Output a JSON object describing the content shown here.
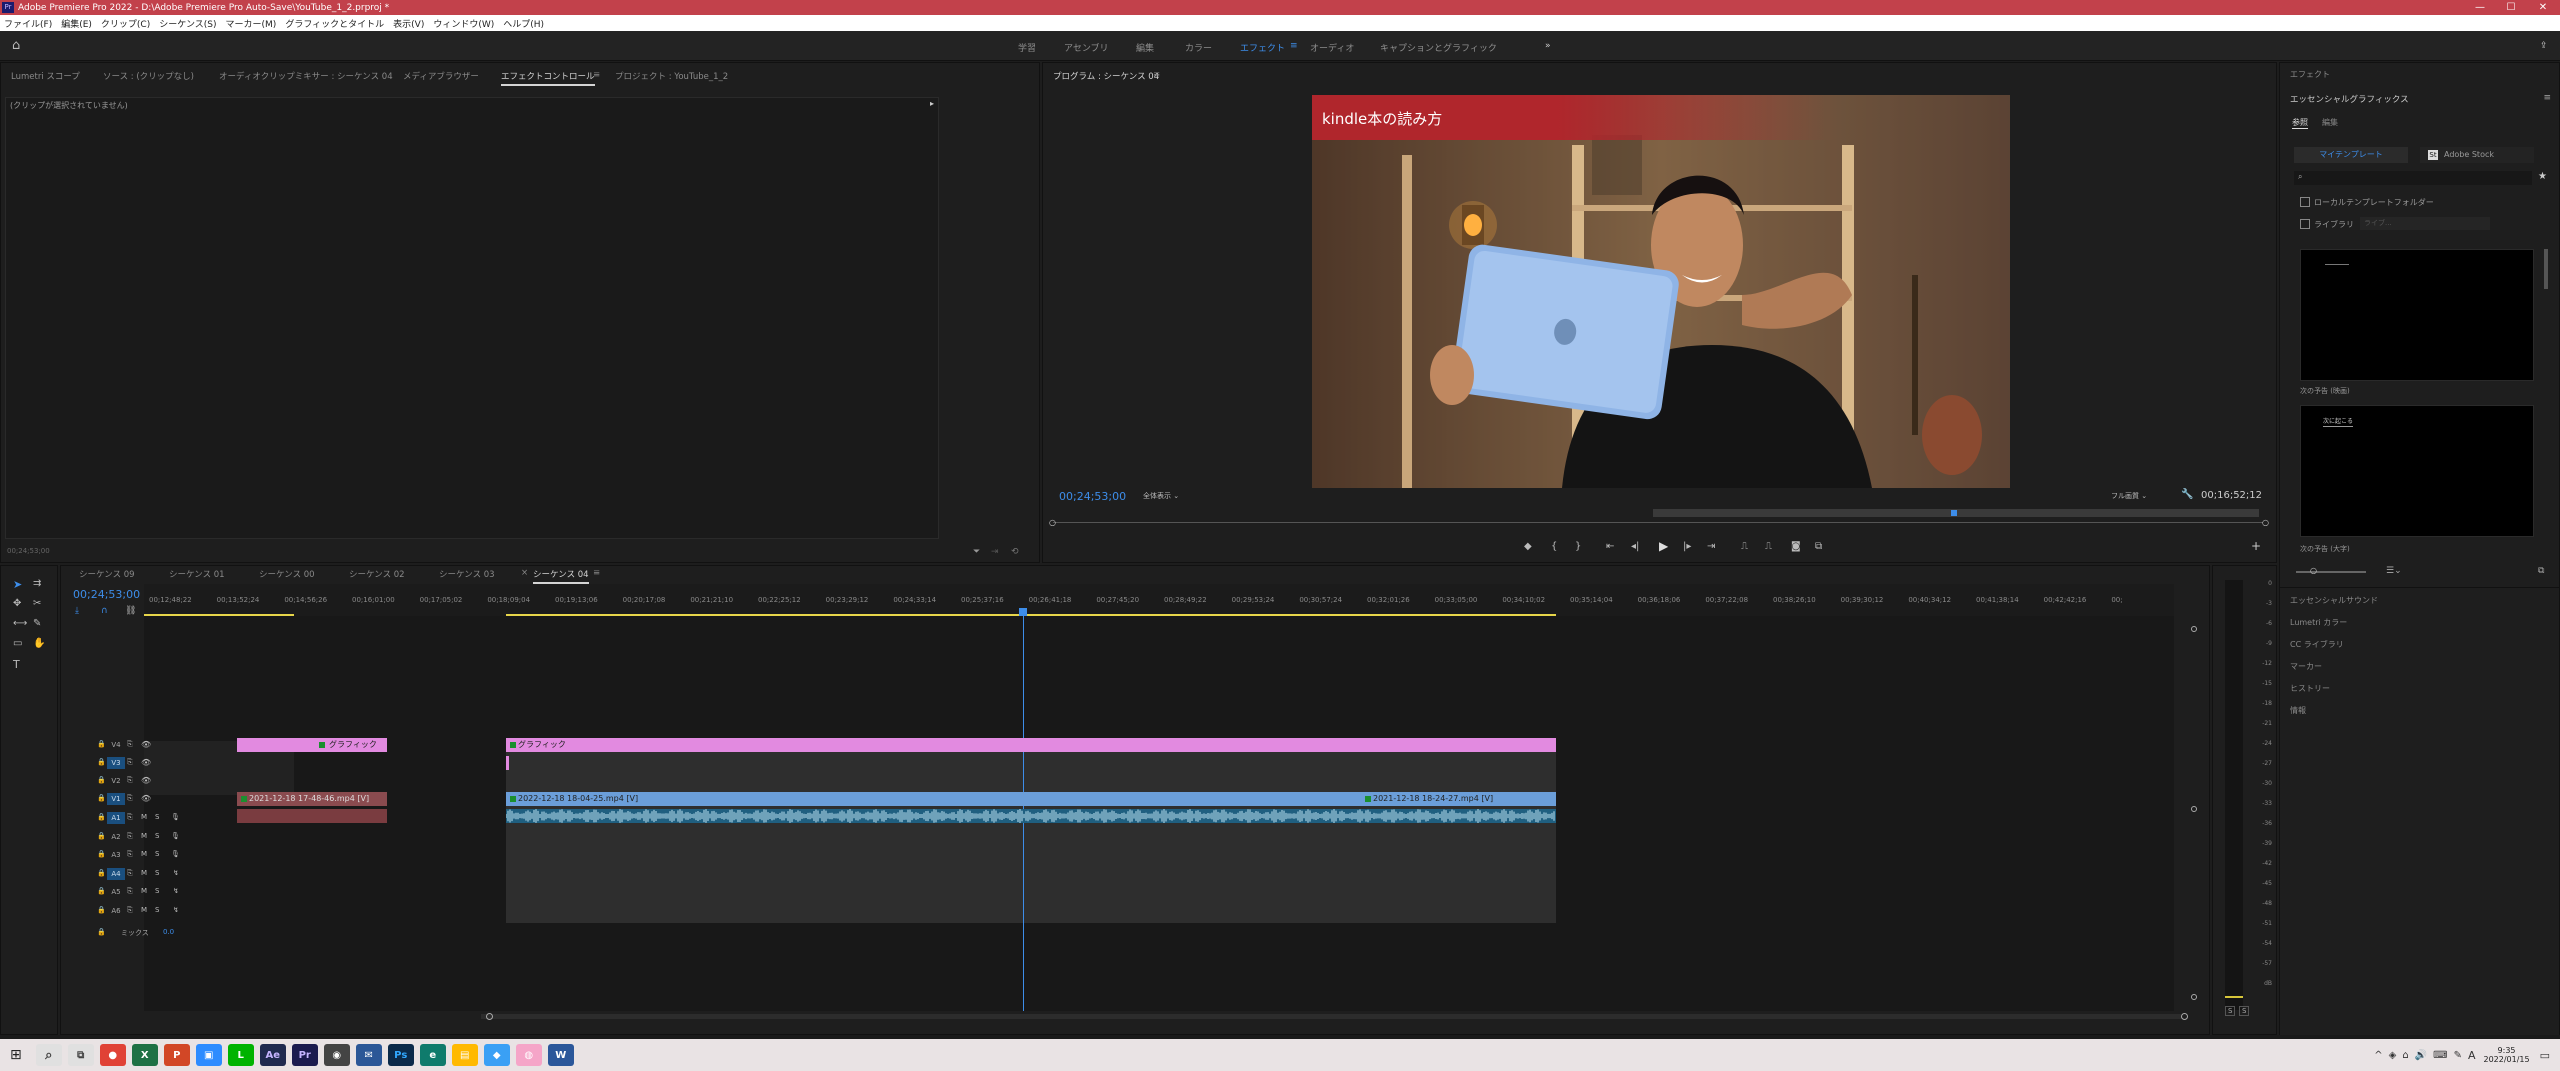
{
  "titlebar": {
    "app_icon": "Pr",
    "title": "Adobe Premiere Pro 2022 - D:\\Adobe Premiere Pro Auto-Save\\YouTube_1_2.prproj *",
    "minimize": "—",
    "maximize": "☐",
    "close": "✕"
  },
  "menu": [
    "ファイル(F)",
    "編集(E)",
    "クリップ(C)",
    "シーケンス(S)",
    "マーカー(M)",
    "グラフィックとタイトル",
    "表示(V)",
    "ウィンドウ(W)",
    "ヘルプ(H)"
  ],
  "workspaces": [
    "学習",
    "アセンブリ",
    "編集",
    "カラー",
    "エフェクト",
    "オーディオ",
    "キャプションとグラフィック"
  ],
  "workspaces_active": "エフェクト",
  "source_panel": {
    "tabs": [
      "Lumetri スコープ",
      "ソース : (クリップなし)",
      "オーディオクリップミキサー : シーケンス 04",
      "メディアブラウザー",
      "エフェクトコントロール",
      "プロジェクト : YouTube_1_2"
    ],
    "active_tab": "エフェクトコントロール",
    "no_clip_text": "(クリップが選択されていません)",
    "timecode": "00;24;53;00"
  },
  "program": {
    "tab": "プログラム : シーケンス 04",
    "title_overlay": "kindle本の読み方",
    "timecode": "00;24;53;00",
    "fit": "全体表示",
    "quality": "フル画質",
    "duration": "00;16;52;12"
  },
  "sequence_tabs": [
    "シーケンス 09",
    "シーケンス 01",
    "シーケンス 00",
    "シーケンス 02",
    "シーケンス 03",
    "シーケンス 04"
  ],
  "active_sequence": "シーケンス 04",
  "timeline": {
    "timecode": "00;24;53;00",
    "ruler": [
      "00;12;48;22",
      "00;13;52;24",
      "00;14;56;26",
      "00;16;01;00",
      "00;17;05;02",
      "00;18;09;04",
      "00;19;13;06",
      "00;20;17;08",
      "00;21;21;10",
      "00;22;25;12",
      "00;23;29;12",
      "00;24;33;14",
      "00;25;37;16",
      "00;26;41;18",
      "00;27;45;20",
      "00;28;49;22",
      "00;29;53;24",
      "00;30;57;24",
      "00;32;01;26",
      "00;33;05;00",
      "00;34;10;02",
      "00;35;14;04",
      "00;36;18;06",
      "00;37;22;08",
      "00;38;26;10",
      "00;39;30;12",
      "00;40;34;12",
      "00;41;38;14",
      "00;42;42;16",
      "00;"
    ],
    "video_tracks": [
      "V4",
      "V3",
      "V2",
      "V1"
    ],
    "audio_tracks": [
      "A1",
      "A2",
      "A3",
      "A4",
      "A5",
      "A6"
    ],
    "mix_label": "ミックス",
    "mix_value": "0.0",
    "clip_graphic": "グラフィック",
    "clip_v1a": "2021-12-18 17-48-46.mp4 [V]",
    "clip_v1b": "2022-12-18 18-04-25.mp4 [V]",
    "clip_v1c": "2021-12-18 18-24-27.mp4 [V]"
  },
  "vu_ticks": [
    "0",
    "-3",
    "-6",
    "-9",
    "-12",
    "-15",
    "-18",
    "-21",
    "-24",
    "-27",
    "-30",
    "-33",
    "-36",
    "-39",
    "-42",
    "-45",
    "-48",
    "-51",
    "-54",
    "-57",
    "dB"
  ],
  "vu_solo": [
    "S",
    "S"
  ],
  "essential": {
    "effects_header": "エフェクト",
    "title": "エッセンシャルグラフィックス",
    "tab_browse": "参照",
    "tab_edit": "編集",
    "btn_templates": "マイテンプレート",
    "btn_stock": "Adobe Stock",
    "chk_local": "ローカルテンプレートフォルダー",
    "chk_library": "ライブラリ",
    "library_placeholder": "ライブ...",
    "template1_caption": "次の予告 (映画)",
    "template2_caption": "次の予告 (大字)",
    "template2_text": "次に起こる",
    "panels": [
      "エッセンシャルサウンド",
      "Lumetri カラー",
      "CC ライブラリ",
      "マーカー",
      "ヒストリー",
      "情報"
    ]
  },
  "taskbar": {
    "time": "9:35",
    "date": "2022/01/15",
    "ime": "A"
  }
}
